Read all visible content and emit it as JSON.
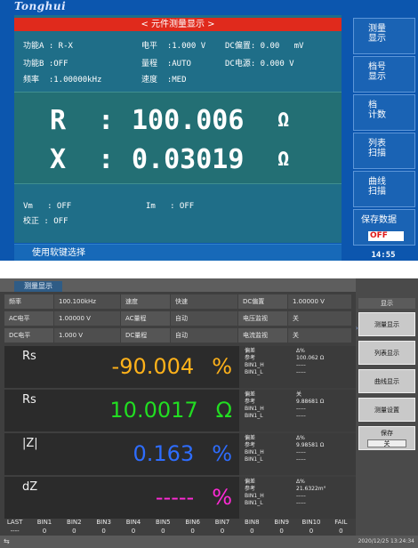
{
  "top": {
    "logo": "Tonghui",
    "title": "< 元件测量显示 >",
    "lines": [
      {
        "a": "功能A : R-X",
        "b": "电平  :1.000 V",
        "c": "DC偏置: 0.00   mV"
      },
      {
        "a": "功能B :OFF",
        "b": "量程  :AUTO",
        "c": "DC电源: 0.000 V"
      },
      {
        "a": "频率  :1.00000kHz",
        "b": "速度  :MED",
        "c": ""
      }
    ],
    "readings": [
      {
        "param": "R  :",
        "value": "100.006",
        "unit": "Ω"
      },
      {
        "param": "X  :",
        "value": "0.03019",
        "unit": "Ω"
      }
    ],
    "vm": "Vm   : OFF",
    "im": "Im   : OFF",
    "correct": "校正 : OFF",
    "status": "使用软键选择",
    "softkeys": [
      {
        "l1": "测量",
        "l2": "显示"
      },
      {
        "l1": "档号",
        "l2": "显示"
      },
      {
        "l1": "档",
        "l2": "计数"
      },
      {
        "l1": "列表",
        "l2": "扫描"
      },
      {
        "l1": "曲线",
        "l2": "扫描"
      },
      {
        "l1": "保存数据",
        "l2": ""
      }
    ],
    "save_state": "OFF",
    "clock": "14:55"
  },
  "bottom": {
    "tab": "测量显示",
    "settings": [
      [
        "频率",
        "100.100kHz",
        "速度",
        "快速",
        "DC偏置",
        "1.00000 V"
      ],
      [
        "AC电平",
        "1.00000 V",
        "AC量程",
        "自动",
        "电压监视",
        "关"
      ],
      [
        "DC电平",
        "1.000 V",
        "DC量程",
        "自动",
        "电流监视",
        "关"
      ]
    ],
    "rows": [
      {
        "label": "Rs",
        "value": "-90.004",
        "unit": "%",
        "color": "#ffb21a",
        "side": [
          "偏差",
          "参考",
          "BIN1_H",
          "BIN1_L"
        ],
        "sidev": [
          "Δ%",
          "100.062 Ω",
          "-----",
          "-----"
        ]
      },
      {
        "label": "Rs",
        "value": "10.0017",
        "unit": "Ω",
        "color": "#22dd22",
        "side": [
          "偏差",
          "参考",
          "BIN1_H",
          "BIN1_L"
        ],
        "sidev": [
          "关",
          "9.88681 Ω",
          "-----",
          "-----"
        ]
      },
      {
        "label": "|Z|",
        "value": "0.163",
        "unit": "%",
        "color": "#2e6dff",
        "side": [
          "偏差",
          "参考",
          "BIN1_H",
          "BIN1_L"
        ],
        "sidev": [
          "Δ%",
          "9.98581 Ω",
          "-----",
          "-----"
        ]
      },
      {
        "label": "dZ",
        "value": "-----",
        "unit": "%",
        "color": "#ff2ad6",
        "side": [
          "偏差",
          "参考",
          "BIN1_H",
          "BIN1_L"
        ],
        "sidev": [
          "Δ%",
          "21.6322m°",
          "-----",
          "-----"
        ]
      }
    ],
    "bins": {
      "headers": [
        "LAST",
        "BIN1",
        "BIN2",
        "BIN3",
        "BIN4",
        "BIN5",
        "BIN6",
        "BIN7",
        "BIN8",
        "BIN9",
        "BIN10",
        "FAIL"
      ],
      "values": [
        "----",
        "0",
        "0",
        "0",
        "0",
        "0",
        "0",
        "0",
        "0",
        "0",
        "0",
        "0"
      ]
    },
    "side_title": "显示",
    "side_buttons": [
      "测量显示",
      "列表显示",
      "曲线显示",
      "测量设置"
    ],
    "save_label": "保存",
    "save_value": "关",
    "clock": "2020/12/25 13:24:34",
    "colors": {
      "accent": "#2f5c86"
    }
  }
}
